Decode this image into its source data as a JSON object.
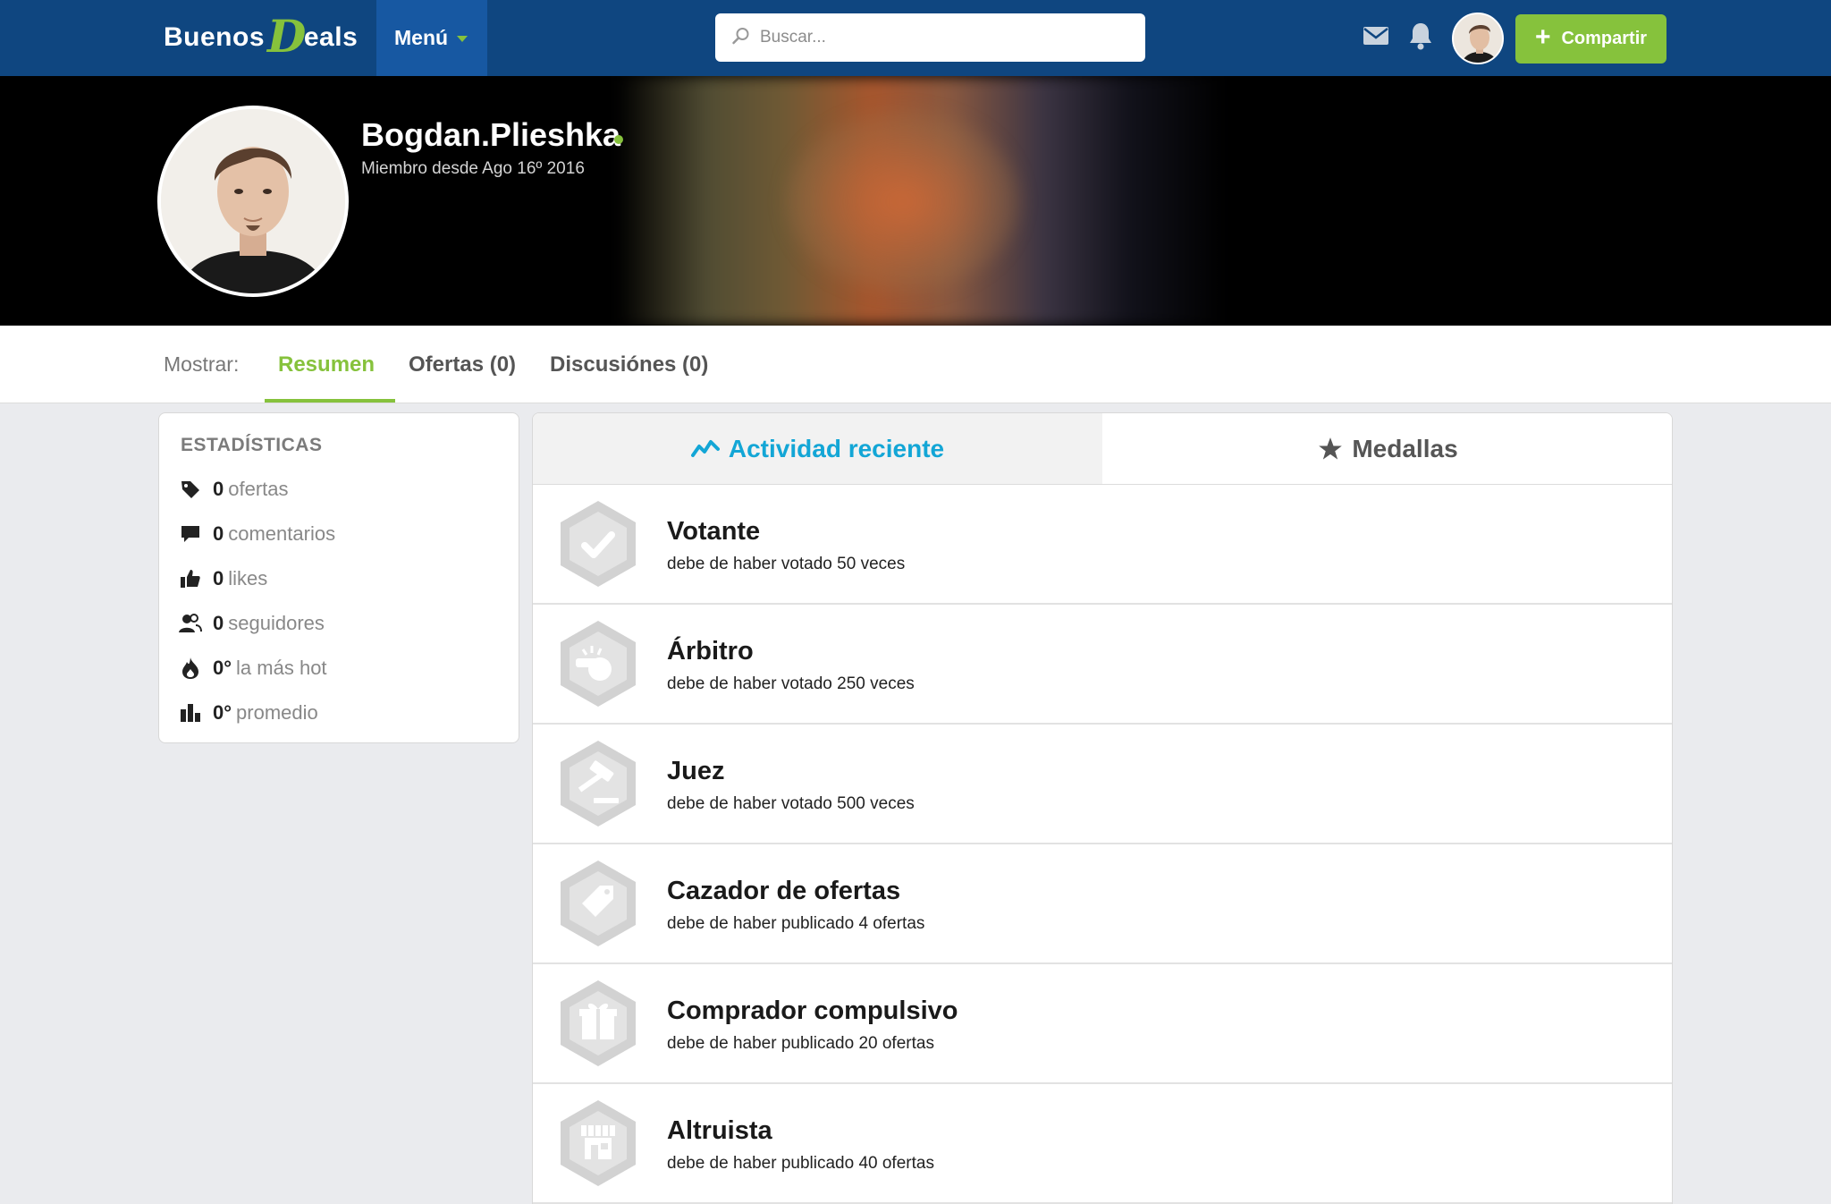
{
  "header": {
    "logo_part1": "Buenos",
    "logo_d": "D",
    "logo_part2": "eals",
    "menu_label": "Menú",
    "search_placeholder": "Buscar...",
    "share_label": "Compartir"
  },
  "profile": {
    "username": "Bogdan.Plieshka",
    "member_since": "Miembro desde Ago 16º 2016",
    "online": true
  },
  "tabs": {
    "prefix": "Mostrar:",
    "items": [
      {
        "label": "Resumen",
        "active": true
      },
      {
        "label": "Ofertas (0)",
        "active": false
      },
      {
        "label": "Discusiónes (0)",
        "active": false
      }
    ]
  },
  "stats": {
    "title": "ESTADÍSTICAS",
    "items": [
      {
        "icon": "tag-icon",
        "value": "0",
        "label": "ofertas"
      },
      {
        "icon": "comment-icon",
        "value": "0",
        "label": "comentarios"
      },
      {
        "icon": "thumbs-up-icon",
        "value": "0",
        "label": "likes"
      },
      {
        "icon": "users-icon",
        "value": "0",
        "label": "seguidores"
      },
      {
        "icon": "flame-icon",
        "value": "0°",
        "label": "la más hot"
      },
      {
        "icon": "bar-chart-icon",
        "value": "0°",
        "label": "promedio"
      }
    ]
  },
  "panel": {
    "tab_activity": "Actividad reciente",
    "tab_medals": "Medallas",
    "badges": [
      {
        "icon": "checkmark-icon",
        "title": "Votante",
        "description": "debe de haber votado 50 veces"
      },
      {
        "icon": "whistle-icon",
        "title": "Árbitro",
        "description": "debe de haber votado 250 veces"
      },
      {
        "icon": "gavel-icon",
        "title": "Juez",
        "description": "debe de haber votado 500 veces"
      },
      {
        "icon": "tag-icon",
        "title": "Cazador de ofertas",
        "description": "debe de haber publicado 4 ofertas"
      },
      {
        "icon": "gift-icon",
        "title": "Comprador compulsivo",
        "description": "debe de haber publicado 20 ofertas"
      },
      {
        "icon": "store-icon",
        "title": "Altruista",
        "description": "debe de haber publicado 40 ofertas"
      }
    ]
  },
  "colors": {
    "header_bg": "#0f4680",
    "menu_bg": "#1758a2",
    "accent_green": "#86c23c",
    "accent_blue": "#13a6d6"
  }
}
